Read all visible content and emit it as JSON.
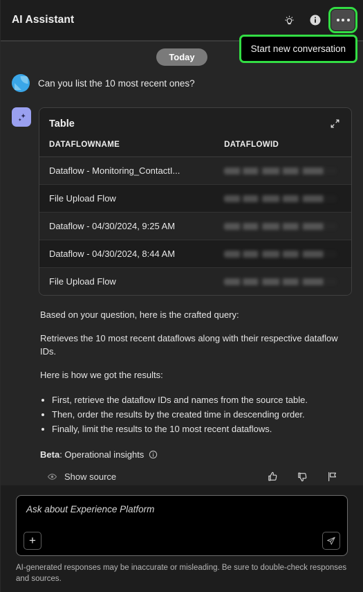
{
  "header": {
    "title": "AI Assistant",
    "icons": [
      {
        "name": "lightbulb-icon",
        "label": "Tips"
      },
      {
        "name": "info-circle-icon",
        "label": "Information"
      },
      {
        "name": "more-options-icon",
        "label": "More options"
      }
    ],
    "tooltip": "Start new conversation",
    "highlight_color": "#33dd44"
  },
  "conversation": {
    "date_divider": "Today",
    "user_message": "Can you list the 10 most recent ones?"
  },
  "table_card": {
    "title": "Table",
    "expand_label": "Expand table",
    "columns": [
      "DATAFLOWNAME",
      "DATAFLOWID"
    ],
    "rows": [
      {
        "name": "Dataflow - Monitoring_ContactI...",
        "id": ""
      },
      {
        "name": "File Upload Flow",
        "id": ""
      },
      {
        "name": "Dataflow - 04/30/2024, 9:25 AM",
        "id": ""
      },
      {
        "name": "Dataflow - 04/30/2024, 8:44 AM",
        "id": ""
      },
      {
        "name": "File Upload Flow",
        "id": ""
      }
    ]
  },
  "response": {
    "para1": "Based on your question, here is the crafted query:",
    "para2": "Retrieves the 10 most recent dataflows along with their respective dataflow IDs.",
    "para3": "Here is how we got the results:",
    "bullets": [
      "First, retrieve the dataflow IDs and names from the source table.",
      "Then, order the results by the created time in descending order.",
      "Finally, limit the results to the 10 most recent dataflows."
    ],
    "beta_label": "Beta",
    "beta_text": ": Operational insights",
    "show_source": "Show source",
    "feedback": [
      {
        "name": "thumbs-up-icon"
      },
      {
        "name": "thumbs-down-icon"
      },
      {
        "name": "flag-icon"
      }
    ]
  },
  "composer": {
    "placeholder": "Ask about Experience Platform",
    "value": "",
    "attach_label": "+",
    "send_label": "Send"
  },
  "footer": {
    "disclaimer": "AI-generated responses may be inaccurate or misleading. Be sure to double-check responses and sources."
  }
}
